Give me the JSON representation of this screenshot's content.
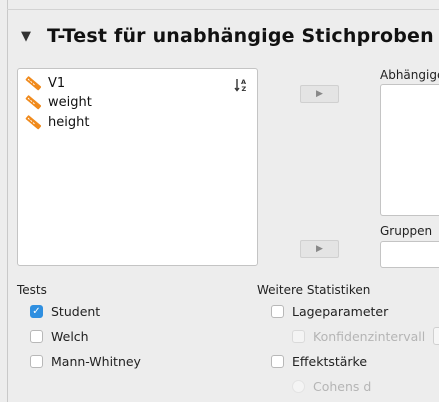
{
  "panel": {
    "title": "T-Test für unabhängige Stichproben",
    "collapse_icon": "triangle-down-icon"
  },
  "variables": {
    "items": [
      {
        "label": "V1",
        "icon": "scale-ruler-icon"
      },
      {
        "label": "weight",
        "icon": "scale-ruler-icon"
      },
      {
        "label": "height",
        "icon": "scale-ruler-icon"
      }
    ],
    "sort_icon_text": "↓A Z"
  },
  "targets": {
    "dependent_label": "Abhängige",
    "group_label": "Gruppen",
    "move_icon": "▶"
  },
  "tests": {
    "label": "Tests",
    "options": [
      {
        "label": "Student",
        "checked": true
      },
      {
        "label": "Welch",
        "checked": false
      },
      {
        "label": "Mann-Whitney",
        "checked": false
      }
    ]
  },
  "stats": {
    "label": "Weitere Statistiken",
    "location": {
      "label": "Lageparameter",
      "checked": false
    },
    "ci": {
      "label": "Konfidenzintervall",
      "checked": false,
      "disabled": true
    },
    "effect": {
      "label": "Effektstärke",
      "checked": false
    },
    "cohens": {
      "label": "Cohens d",
      "disabled": true
    }
  },
  "colors": {
    "accent": "#2f8fe0",
    "ruler": "#f08a1c"
  }
}
